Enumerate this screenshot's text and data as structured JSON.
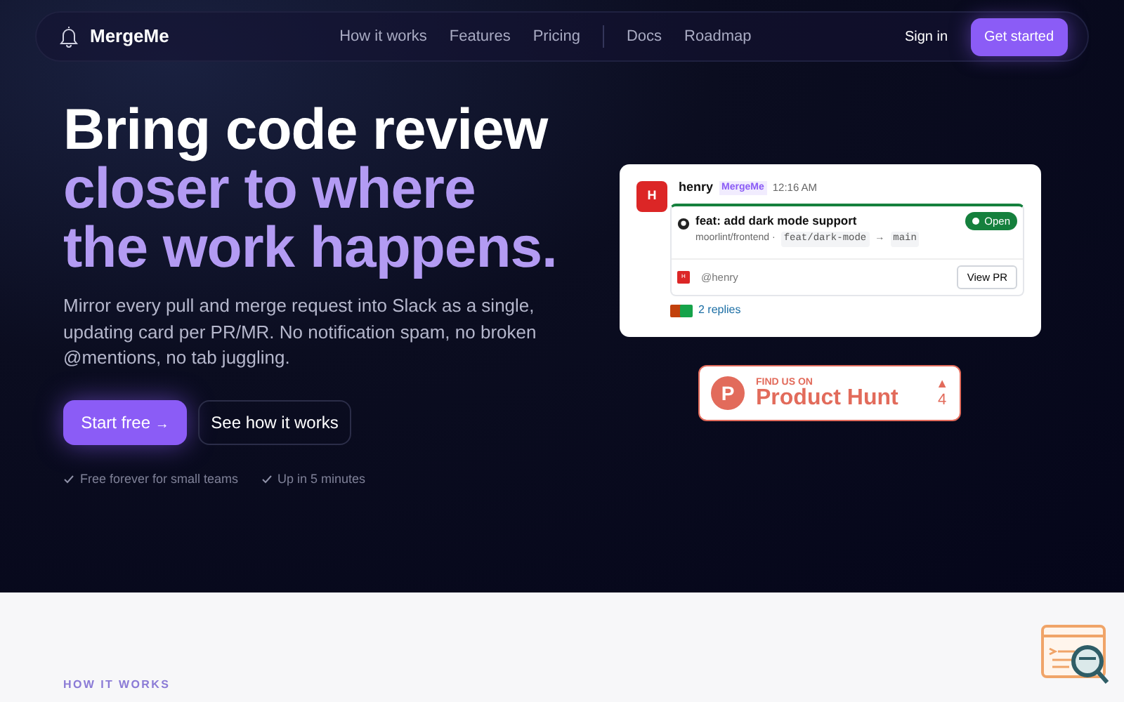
{
  "nav": {
    "brand": "MergeMe",
    "links": [
      {
        "label": "How it works"
      },
      {
        "label": "Features"
      },
      {
        "label": "Pricing"
      },
      {
        "label": "Docs",
        "divider_before": true
      },
      {
        "label": "Roadmap"
      }
    ],
    "sign_in": "Sign in",
    "cta": "Get started"
  },
  "hero": {
    "headline": "Bring code review",
    "headline_accent": "closer to where the work happens.",
    "lead": "Mirror every pull and merge request into Slack as a single, updating card per PR/MR. No notification spam, no broken @mentions, no tab juggling.",
    "primary": "Start free",
    "primary_arrow": "→",
    "secondary": "See how it works",
    "checks": [
      "Free forever for small teams",
      "Up in 5 minutes"
    ]
  },
  "slack_card": {
    "avatar": "H",
    "user": "henry",
    "app_tag": "MergeMe",
    "time": "12:16 AM",
    "pr_title": "feat: add dark mode support",
    "repo": "moorlint/frontend ·",
    "branch": "feat/dark-mode",
    "arrow": "→",
    "base": "main",
    "status": "Open",
    "author_avatar": "H",
    "author": "@henry",
    "view_button": "View PR",
    "replies": "2 replies"
  },
  "product_hunt": {
    "eyebrow": "FIND US ON",
    "name": "Product Hunt",
    "logo": "P",
    "upvote": "▲",
    "votes": "4"
  },
  "section": {
    "eyebrow": "HOW IT WORKS"
  }
}
